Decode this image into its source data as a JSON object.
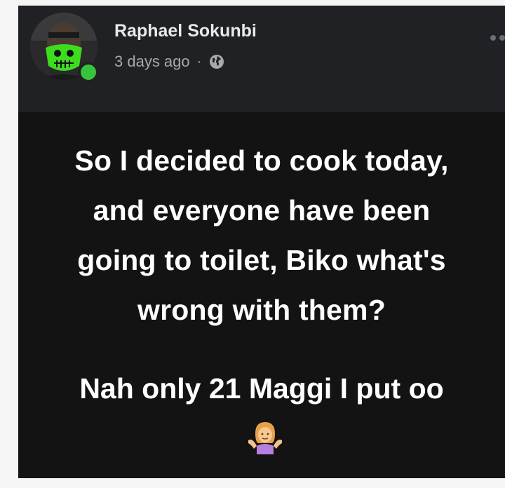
{
  "post": {
    "author_name": "Raphael Sokunbi",
    "time_ago": "3 days ago",
    "separator": "·",
    "privacy_icon": "globe-icon",
    "more_icon": "more-dots-icon",
    "online_status": "online",
    "text_lines": [
      "So I decided to cook today,",
      "and everyone have been",
      "going to toilet, Biko what's",
      "wrong with them?"
    ],
    "second_paragraph": "Nah only 21 Maggi I put oo",
    "emoji_icon": "person-shrugging-emoji",
    "colors": {
      "header_bg": "#1f2124",
      "body_bg": "#131313",
      "online": "#37c43a",
      "mask_green": "#3ddc1f"
    }
  }
}
